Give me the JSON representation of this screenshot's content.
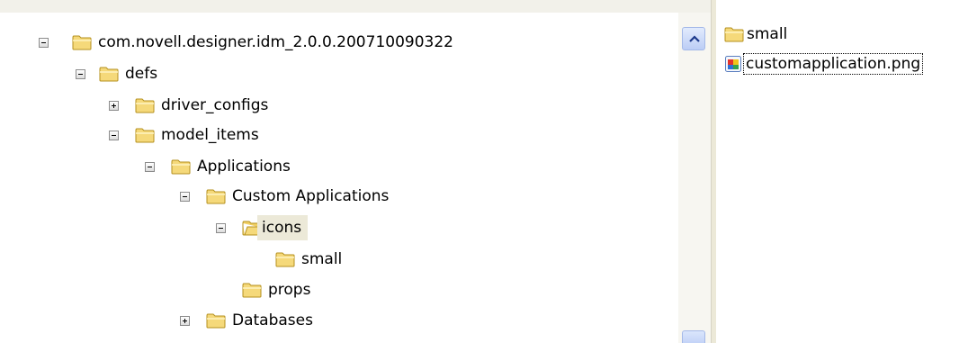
{
  "tree": {
    "nodes": [
      {
        "label": "com.novell.designer.idm_2.0.0.200710090322",
        "expander": "minus"
      },
      {
        "label": "defs",
        "expander": "minus"
      },
      {
        "label": "driver_configs",
        "expander": "plus"
      },
      {
        "label": "model_items",
        "expander": "minus"
      },
      {
        "label": "Applications",
        "expander": "minus"
      },
      {
        "label": "Custom Applications",
        "expander": "minus"
      },
      {
        "label": "icons",
        "expander": "minus",
        "selected": true
      },
      {
        "label": "small",
        "expander": "none"
      },
      {
        "label": "props",
        "expander": "none"
      },
      {
        "label": "Databases",
        "expander": "plus"
      }
    ],
    "folder_icon": "folder-icon",
    "expander_icons": [
      "minus-box-icon",
      "plus-box-icon"
    ]
  },
  "scrollbar": {
    "up_icon": "chevron-up-icon"
  },
  "files": {
    "items": [
      {
        "name": "small",
        "icon": "folder-icon"
      },
      {
        "name": "customapplication.png",
        "icon": "png-file-icon",
        "focused": true
      }
    ]
  },
  "colors": {
    "folder": "#f5d97a",
    "selection": "#ece9d8",
    "scroll": "#c1d3fb"
  }
}
